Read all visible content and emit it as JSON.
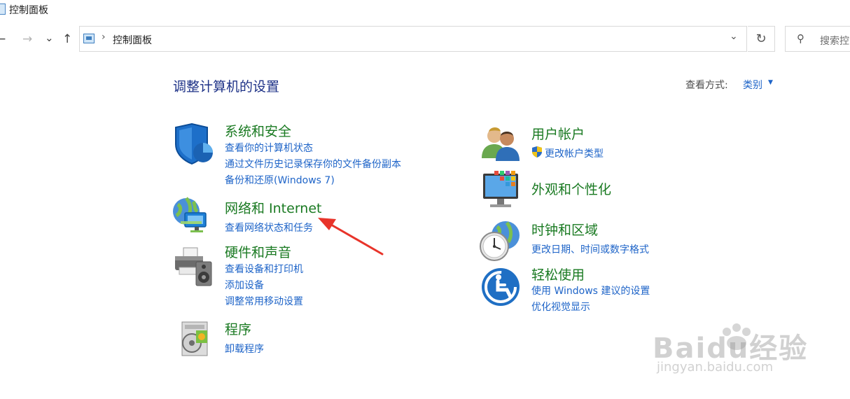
{
  "window": {
    "title": "控制面板"
  },
  "nav": {
    "back_icon": "←",
    "forward_icon": "→",
    "recent_icon": "⌄",
    "up_icon": "↑"
  },
  "address": {
    "path": "控制面板",
    "separator": "›",
    "dropdown_icon": "⌄"
  },
  "refresh_icon": "↻",
  "search": {
    "placeholder": "搜索控",
    "icon": "⚲"
  },
  "main": {
    "heading": "调整计算机的设置",
    "view_by_label": "查看方式:",
    "view_by_value": "类别",
    "view_by_caret": "▼"
  },
  "categories_left": [
    {
      "title": "系统和安全",
      "links": [
        "查看你的计算机状态",
        "通过文件历史记录保存你的文件备份副本",
        "备份和还原(Windows 7)"
      ]
    },
    {
      "title": "网络和 Internet",
      "links": [
        "查看网络状态和任务"
      ]
    },
    {
      "title": "硬件和声音",
      "links": [
        "查看设备和打印机",
        "添加设备",
        "调整常用移动设置"
      ]
    },
    {
      "title": "程序",
      "links": [
        "卸载程序"
      ]
    }
  ],
  "categories_right": [
    {
      "title": "用户帐户",
      "links": [
        "更改帐户类型"
      ]
    },
    {
      "title": "外观和个性化",
      "links": []
    },
    {
      "title": "时钟和区域",
      "links": [
        "更改日期、时间或数字格式"
      ]
    },
    {
      "title": "轻松使用",
      "links": [
        "使用 Windows 建议的设置",
        "优化视觉显示"
      ]
    }
  ],
  "watermark": {
    "line1": "Baidu经验",
    "line2": "jingyan.baidu.com"
  },
  "colors": {
    "link": "#1e64c8",
    "category": "#1a7a22",
    "heading": "#1e3287",
    "annotation": "#e8342a"
  }
}
